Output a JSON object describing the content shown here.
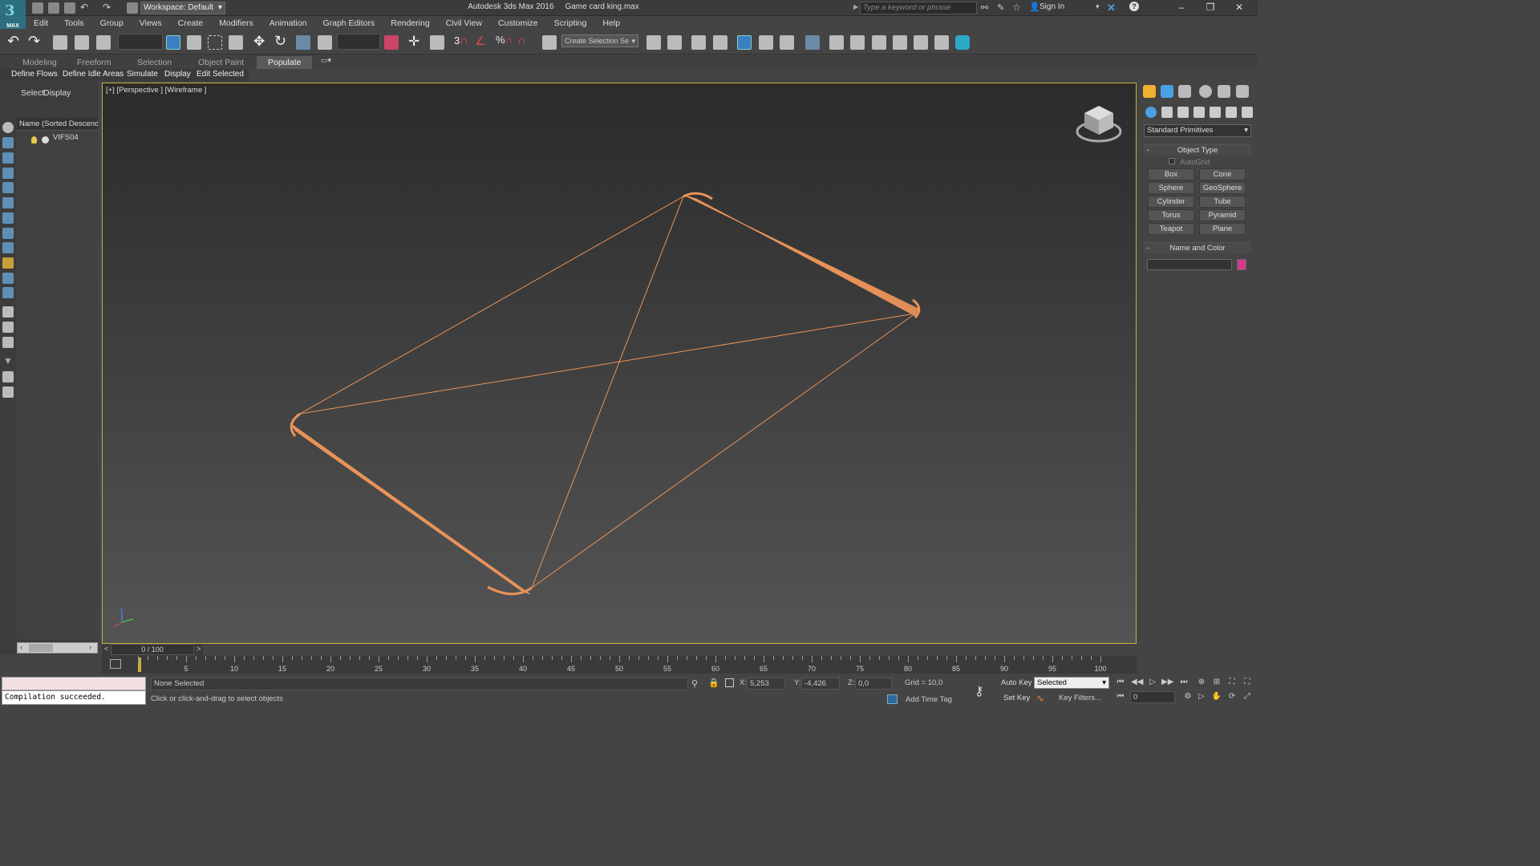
{
  "titlebar": {
    "workspace": "Workspace: Default",
    "app_title": "Autodesk 3ds Max 2016",
    "file_name": "Game card king.max",
    "search_placeholder": "Type a keyword or phrase",
    "sign_in": "Sign In",
    "logo_text": "MAX"
  },
  "menu": [
    "Edit",
    "Tools",
    "Group",
    "Views",
    "Create",
    "Modifiers",
    "Animation",
    "Graph Editors",
    "Rendering",
    "Civil View",
    "Customize",
    "Scripting",
    "Help"
  ],
  "toolbar": {
    "selection_set_placeholder": "Create Selection Se",
    "snap_labels": [
      "3",
      "%"
    ]
  },
  "ribbon": {
    "tabs": [
      "Modeling",
      "Freeform",
      "Selection",
      "Object Paint",
      "Populate"
    ],
    "active_tab": "Populate",
    "sub_tabs": [
      "Define Flows",
      "Define Idle Areas",
      "Simulate",
      "Display",
      "Edit Selected"
    ]
  },
  "scene_explorer": {
    "tabs": [
      "Select",
      "Display"
    ],
    "column_header": "Name (Sorted Descendin",
    "objects": [
      "VIFS04"
    ]
  },
  "viewport": {
    "label": "[+] [Perspective ] [Wireframe ]",
    "wire_color": "#e8935a",
    "frame_counter": "0 / 100",
    "gizmo_axis_label": "z"
  },
  "command_panel": {
    "category": "Standard Primitives",
    "object_type_title": "Object Type",
    "autogrid": "AutoGrid",
    "buttons": [
      "Box",
      "Cone",
      "Sphere",
      "GeoSphere",
      "Cylinder",
      "Tube",
      "Torus",
      "Pyramid",
      "Teapot",
      "Plane"
    ],
    "name_color_title": "Name and Color",
    "object_color": "#d63a8c"
  },
  "timeline": {
    "ticks": [
      "5",
      "10",
      "15",
      "20",
      "25",
      "30",
      "35",
      "40",
      "45",
      "50",
      "55",
      "60",
      "65",
      "70",
      "75",
      "80",
      "85",
      "90",
      "95",
      "100"
    ]
  },
  "status": {
    "maxscript_output": "Compilation succeeded.",
    "selection": "None Selected",
    "hint": "Click or click-and-drag to select objects",
    "x_label": "X:",
    "x_value": "5,253",
    "y_label": "Y:",
    "y_value": "-4,426",
    "z_label": "Z:",
    "z_value": "0,0",
    "grid": "Grid = 10,0",
    "add_time_tag": "Add Time Tag",
    "auto_key": "Auto Key",
    "set_key": "Set Key",
    "selected_mode": "Selected",
    "key_filters": "Key Filters...",
    "current_frame": "0"
  }
}
